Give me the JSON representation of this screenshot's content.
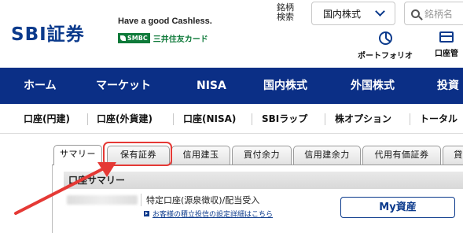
{
  "header": {
    "logo": "SBI証券",
    "tagline": "Have a good Cashless.",
    "partner_badge": "SMBC",
    "partner_name": "三井住友カード",
    "search_label": "銘柄\n検索",
    "market_select": "国内株式",
    "search_placeholder": "銘柄名",
    "portfolio_label": "ポートフォリオ",
    "account_label": "口座管"
  },
  "main_nav": [
    "ホーム",
    "マーケット",
    "NISA",
    "国内株式",
    "外国株式",
    "投資"
  ],
  "sub_nav": [
    "口座(円建)",
    "口座(外貨建)",
    "口座(NISA)",
    "SBIラップ",
    "株オプション",
    "トータル"
  ],
  "tabs": [
    {
      "label": "サマリー",
      "active": true
    },
    {
      "label": "保有証券",
      "active": false
    },
    {
      "label": "信用建玉",
      "active": false
    },
    {
      "label": "買付余力",
      "active": false
    },
    {
      "label": "信用建余力",
      "active": false
    },
    {
      "label": "代用有価証券",
      "active": false
    },
    {
      "label": "貸",
      "active": false
    }
  ],
  "summary": {
    "header": "口座サマリー",
    "account_type": "特定口座(源泉徴収)/配当受入",
    "settings_link": "お客様の積立投信の設定詳細はこちら",
    "my_assets_button": "My資産"
  },
  "colors": {
    "brand_navy": "#0b2f86",
    "link_blue": "#0b3a8c",
    "annotation_red": "#e53935",
    "smbc_green": "#0f7a3a"
  }
}
